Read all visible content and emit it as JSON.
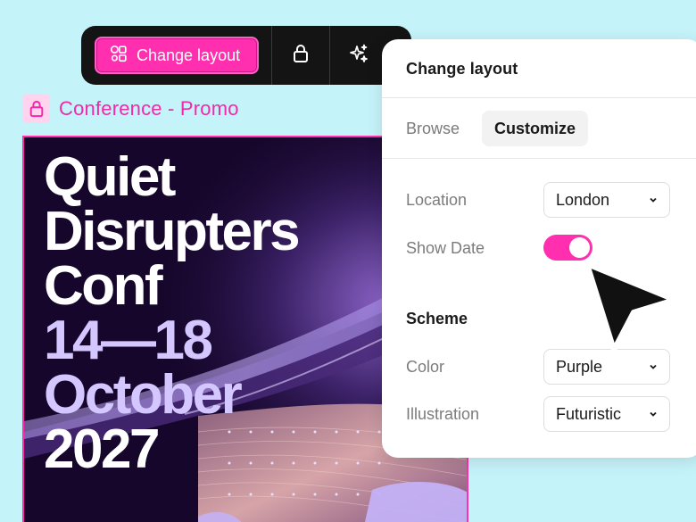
{
  "toolbar": {
    "change_layout_label": "Change layout",
    "buttons": [
      "layout-icon",
      "lock-icon",
      "sparkle-icon"
    ]
  },
  "document": {
    "title": "Conference - Promo"
  },
  "poster": {
    "lines_white": [
      "Quiet",
      "Disrupters",
      "Conf"
    ],
    "lines_violet": [
      "14—18",
      "October"
    ],
    "line_year": "2027"
  },
  "panel": {
    "title": "Change layout",
    "tabs": {
      "browse": "Browse",
      "customize": "Customize"
    },
    "location": {
      "label": "Location",
      "value": "London"
    },
    "show_date": {
      "label": "Show Date",
      "on": true
    },
    "scheme": {
      "title": "Scheme",
      "color": {
        "label": "Color",
        "value": "Purple"
      },
      "illustration": {
        "label": "Illustration",
        "value": "Futuristic"
      }
    }
  },
  "colors": {
    "accent": "#ff2fb0",
    "background": "#c4f3f9",
    "poster_bg": "#16062b",
    "poster_violet_text": "#d4c6ff"
  }
}
